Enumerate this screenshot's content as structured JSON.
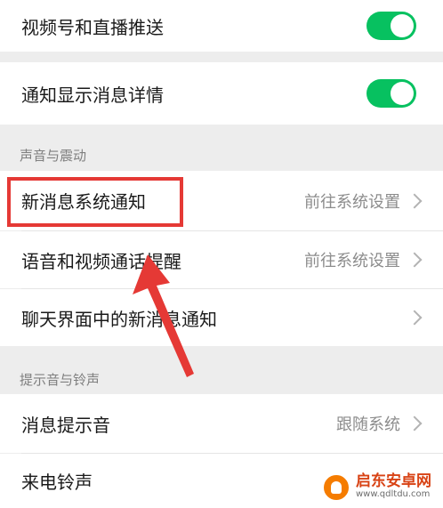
{
  "settings": {
    "channels_push": {
      "label": "视频号和直播推送",
      "enabled": true
    },
    "notification_details": {
      "label": "通知显示消息详情",
      "enabled": true
    }
  },
  "sound_vibration": {
    "header": "声音与震动",
    "items": [
      {
        "label": "新消息系统通知",
        "value": "前往系统设置"
      },
      {
        "label": "语音和视频通话提醒",
        "value": "前往系统设置"
      },
      {
        "label": "聊天界面中的新消息通知",
        "value": ""
      }
    ]
  },
  "tones_ringtones": {
    "header": "提示音与铃声",
    "items": [
      {
        "label": "消息提示音",
        "value": "跟随系统"
      },
      {
        "label": "来电铃声",
        "value": ""
      }
    ]
  },
  "watermark": {
    "title": "启东安卓网",
    "url": "www.qdltdu.com"
  },
  "colors": {
    "toggle_on": "#07c160",
    "highlight": "#e53935",
    "background": "#ededed"
  }
}
